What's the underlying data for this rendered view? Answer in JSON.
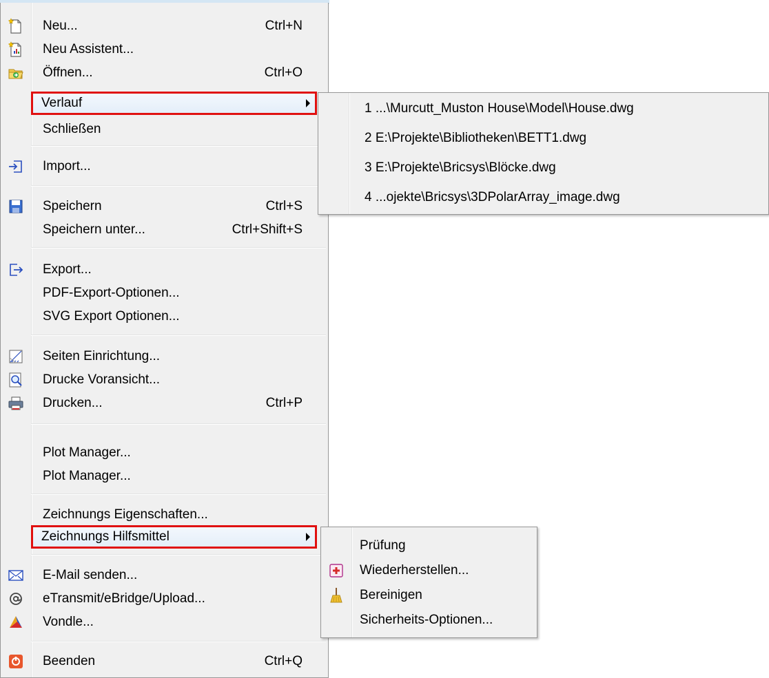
{
  "main_menu": {
    "items": [
      {
        "label": "Neu...",
        "shortcut": "Ctrl+N",
        "icon": "new-file-icon"
      },
      {
        "label": "Neu Assistent...",
        "shortcut": "",
        "icon": "new-wizard-icon"
      },
      {
        "label": "Öffnen...",
        "shortcut": "Ctrl+O",
        "icon": "open-folder-icon"
      },
      {
        "label": "Verlauf",
        "shortcut": "",
        "icon": ""
      },
      {
        "label": "Schließen",
        "shortcut": "",
        "icon": ""
      },
      {
        "label": "Import...",
        "shortcut": "",
        "icon": "import-icon"
      },
      {
        "label": "Speichern",
        "shortcut": "Ctrl+S",
        "icon": "save-disk-icon"
      },
      {
        "label": "Speichern unter...",
        "shortcut": "Ctrl+Shift+S",
        "icon": ""
      },
      {
        "label": "Export...",
        "shortcut": "",
        "icon": "export-icon"
      },
      {
        "label": "PDF-Export-Optionen...",
        "shortcut": "",
        "icon": ""
      },
      {
        "label": "SVG Export Optionen...",
        "shortcut": "",
        "icon": ""
      },
      {
        "label": "Seiten Einrichtung...",
        "shortcut": "",
        "icon": "page-setup-icon"
      },
      {
        "label": "Drucke Voransicht...",
        "shortcut": "",
        "icon": "print-preview-icon"
      },
      {
        "label": "Drucken...",
        "shortcut": "Ctrl+P",
        "icon": "printer-icon"
      },
      {
        "label": "Plot Manager...",
        "shortcut": "",
        "icon": ""
      },
      {
        "label": "Plot Manager...",
        "shortcut": "",
        "icon": ""
      },
      {
        "label": "Zeichnungs Eigenschaften...",
        "shortcut": "",
        "icon": ""
      },
      {
        "label": "Zeichnungs Hilfsmittel",
        "shortcut": "",
        "icon": ""
      },
      {
        "label": "E-Mail senden...",
        "shortcut": "",
        "icon": "envelope-icon"
      },
      {
        "label": "eTransmit/eBridge/Upload...",
        "shortcut": "",
        "icon": "at-sign-icon"
      },
      {
        "label": "Vondle...",
        "shortcut": "",
        "icon": "vondle-logo-icon"
      },
      {
        "label": "Beenden",
        "shortcut": "Ctrl+Q",
        "icon": "power-exit-icon"
      }
    ]
  },
  "history_submenu": {
    "items": [
      {
        "label": "1 ...\\Murcutt_Muston House\\Model\\House.dwg"
      },
      {
        "label": "2 E:\\Projekte\\Bibliotheken\\BETT1.dwg"
      },
      {
        "label": "3 E:\\Projekte\\Bricsys\\Blöcke.dwg"
      },
      {
        "label": "4 ...ojekte\\Bricsys\\3DPolarArray_image.dwg"
      }
    ]
  },
  "tools_submenu": {
    "items": [
      {
        "label": "Prüfung",
        "icon": ""
      },
      {
        "label": "Wiederherstellen...",
        "icon": "recover-cross-icon"
      },
      {
        "label": "Bereinigen",
        "icon": "broom-icon"
      },
      {
        "label": "Sicherheits-Optionen...",
        "icon": ""
      }
    ]
  },
  "colors": {
    "highlight_border": "#e01010",
    "menu_background": "#f0f0f0",
    "menu_border": "#979797"
  }
}
